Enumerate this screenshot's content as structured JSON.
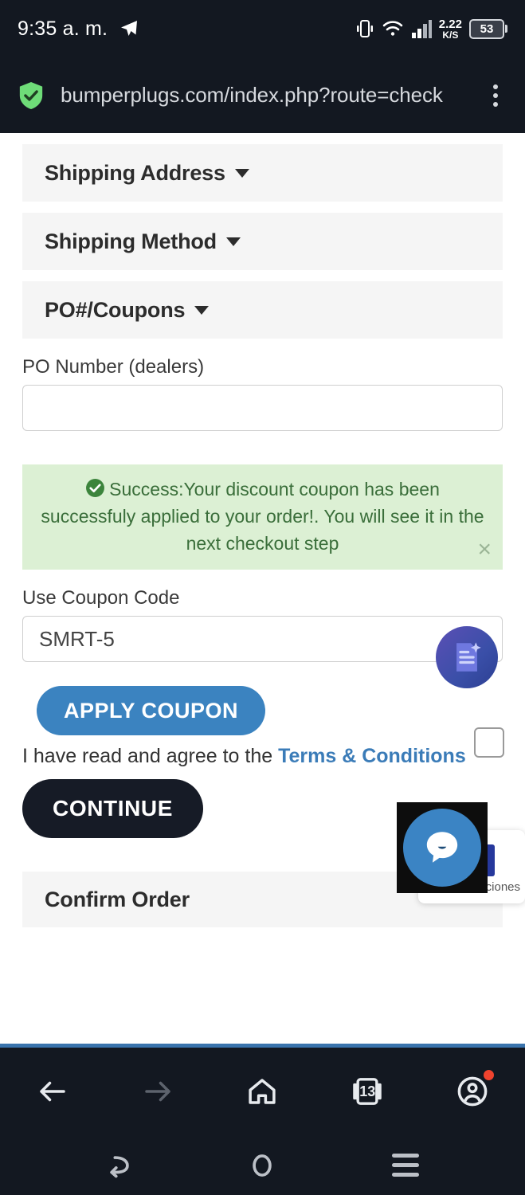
{
  "status_bar": {
    "time": "9:35 a. m.",
    "telegram_icon": "telegram-icon",
    "vibrate_icon": "vibrate-icon",
    "wifi_icon": "wifi-icon",
    "signal_icon": "signal-bars-icon",
    "data_rate_value": "2.22",
    "data_rate_unit": "K/S",
    "battery_level": "53"
  },
  "browser": {
    "security_icon": "shield-check-icon",
    "url": "bumperplugs.com/index.php?route=check",
    "menu_icon": "kebab-menu-icon"
  },
  "page": {
    "accordions": [
      {
        "label": "Shipping Address",
        "caret": "chevron-down-icon"
      },
      {
        "label": "Shipping Method",
        "caret": "chevron-down-icon"
      },
      {
        "label": "PO#/Coupons",
        "caret": "chevron-down-icon"
      }
    ],
    "po_number": {
      "label": "PO Number (dealers)",
      "value": "",
      "placeholder": ""
    },
    "alert": {
      "icon": "check-circle-icon",
      "message": "Success:Your discount coupon has been successfuly applied to your order!. You will see it in the next checkout step",
      "close_label": "×",
      "bg_color": "#dcf0d4",
      "text_color": "#3a6e3a"
    },
    "coupon": {
      "label": "Use Coupon Code",
      "value": "SMRT-5",
      "placeholder": ""
    },
    "apply_button": {
      "label": "APPLY COUPON",
      "color": "#3b83c0"
    },
    "terms": {
      "prefix": "I have read and agree to the ",
      "link_label": "Terms & Conditions",
      "link_color": "#3b7cb8",
      "checkbox_checked": false
    },
    "continue_button": {
      "label": "CONTINUE",
      "color": "#161b26"
    },
    "confirm_panel": {
      "label": "Confirm Order"
    },
    "ai_widget_icon": "document-sparkle-icon",
    "chat_widget": {
      "icon": "chat-bubble-icon",
      "color": "#3b84c4",
      "card_text": "ciones"
    }
  },
  "browser_nav": {
    "back_icon": "arrow-left-icon",
    "forward_icon": "arrow-right-icon",
    "home_icon": "home-icon",
    "tabs_icon": "tabs-icon",
    "tabs_count": "13",
    "profile_icon": "account-circle-icon",
    "profile_has_notification": true
  },
  "system_nav": {
    "back_icon": "system-back-icon",
    "home_icon": "system-home-icon",
    "recents_icon": "system-recents-icon"
  }
}
